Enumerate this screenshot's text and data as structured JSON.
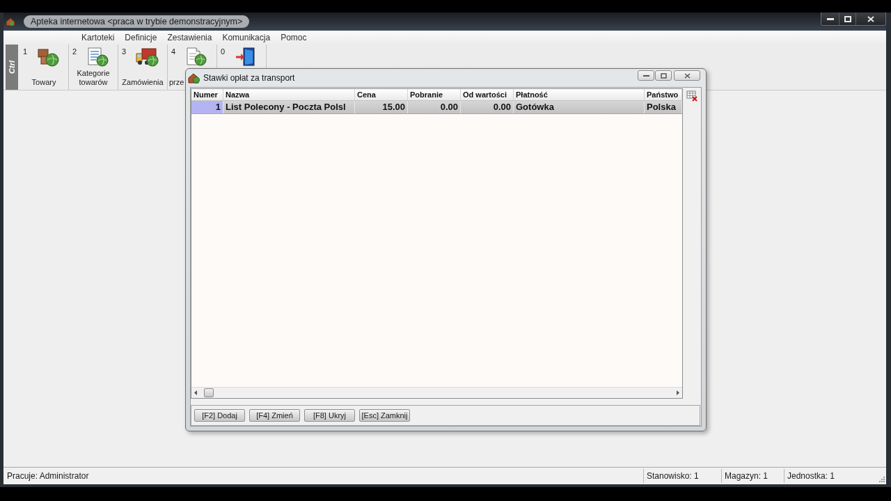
{
  "window": {
    "title": "Apteka internetowa <praca w trybie demonstracyjnym>"
  },
  "menu": [
    "Kartoteki",
    "Definicje",
    "Zestawienia",
    "Komunikacja",
    "Pomoc"
  ],
  "toolbar": {
    "side_label": "Ctrl",
    "buttons": [
      {
        "key": "1",
        "label": "Towary",
        "kind": "boxes"
      },
      {
        "key": "2",
        "label": "Kategorie towarów",
        "kind": "list"
      },
      {
        "key": "3",
        "label": "Zamówienia",
        "kind": "truck"
      },
      {
        "key": "4",
        "label": "prze",
        "kind": "document"
      },
      {
        "key": "0",
        "kind": "exit"
      }
    ]
  },
  "dialog": {
    "title": "Stawki opłat za transport",
    "table": {
      "columns": [
        "Numer",
        "Nazwa",
        "Cena",
        "Pobranie",
        "Od wartości",
        "Płatność",
        "Państwo"
      ],
      "rows": [
        {
          "selected": true,
          "cells": [
            "1",
            "List Polecony - Poczta Polsl",
            "15.00",
            "0.00",
            "0.00",
            "Gotówka",
            "Polska"
          ]
        }
      ]
    },
    "buttons": [
      "[F2] Dodaj",
      "[F4] Zmień",
      "[F8] Ukryj",
      "[Esc] Zamknij"
    ]
  },
  "status_bar": {
    "user": "Pracuje: Administrator",
    "panels": [
      "Stanowisko: 1",
      "Magazyn: 1",
      "Jednostka: 1"
    ]
  }
}
